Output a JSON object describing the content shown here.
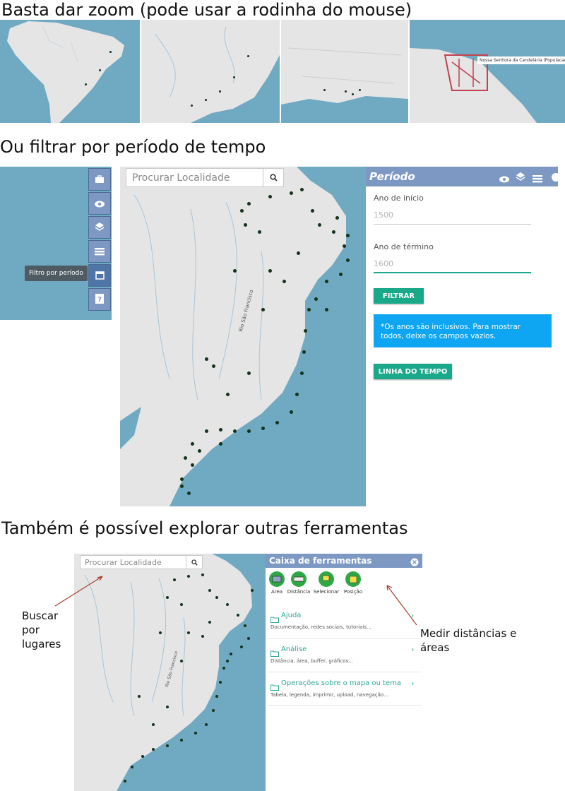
{
  "headings": {
    "zoom": "Basta dar zoom (pode usar a rodinha do mouse)",
    "filter": "Ou filtrar por período de tempo",
    "tools": "Também é possível explorar outras ferramentas"
  },
  "zoom_maps": {
    "popup_label": "Nossa Senhora da Candelária (Populacao > Freguesia)"
  },
  "toolbar": {
    "buttons": [
      "briefcase-icon",
      "eye-icon",
      "layers-icon",
      "list-icon",
      "calendar-icon",
      "help-icon"
    ],
    "tooltip": "Filtro por período"
  },
  "search": {
    "placeholder": "Procurar Localidade"
  },
  "map_labels": {
    "river": "Rio São Francisco"
  },
  "periodo": {
    "title": "Período",
    "start_label": "Ano de início",
    "start_value": "1500",
    "end_label": "Ano de término",
    "end_value": "1600",
    "filter_button": "FILTRAR",
    "note": "*Os anos são inclusivos. Para mostrar todos, deixe os campos vazios.",
    "timeline_button": "LINHA DO TEMPO"
  },
  "tools_panel": {
    "title": "Caixa de ferramentas",
    "tools": [
      {
        "label": "Área",
        "icon": "area-icon"
      },
      {
        "label": "Distância",
        "icon": "ruler-icon"
      },
      {
        "label": "Selecionar",
        "icon": "select-icon"
      },
      {
        "label": "Posição",
        "icon": "position-icon"
      }
    ],
    "sections": [
      {
        "title": "Ajuda",
        "desc": "Documentação, redes sociais, tutoriais..."
      },
      {
        "title": "Análise",
        "desc": "Distância, área, buffer, gráficos..."
      },
      {
        "title": "Operações sobre o mapa ou tema",
        "desc": "Tabela, legenda, imprimir, upload, navegação..."
      }
    ]
  },
  "annotations": {
    "search": "Buscar por lugares",
    "measure": "Medir distâncias e áreas"
  },
  "colors": {
    "ocean": "#6fa9c2",
    "land": "#e5e5e5",
    "panel_header": "#7d99c3",
    "accent_green": "#1aa88a",
    "note_blue": "#0ea5f2",
    "pin": "#13331b"
  }
}
